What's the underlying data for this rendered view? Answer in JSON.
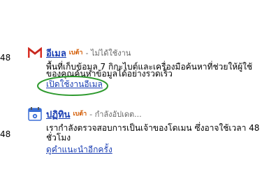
{
  "cut_text": {
    "first": "48",
    "second": "48"
  },
  "services": {
    "mail": {
      "icon": "gmail-m-icon",
      "name": "อีเมล",
      "beta": "เบต้า",
      "status": "- ไม่ได้ใช้งาน",
      "desc_line1": "พื้นที่เก็บข้อมูล 7 กิกะไบต์และเครื่องมือค้นหาที่ช่วยให้ผู้ใช้",
      "desc_line2": "ของคุณค้นหาข้อมูลได้อย่างรวดเร็ว",
      "action": "เปิดใช้งานอีเมล"
    },
    "calendar": {
      "icon": "calendar-icon",
      "name": "ปฏิทิน",
      "beta": "เบต้า",
      "status": "- กำลังอัปเดต...",
      "desc_line1": "เรากำลังตรวจสอบการเป็นเจ้าของโดเมน ซึ่งอาจใช้เวลา 48",
      "desc_line2": "ชั่วโมง",
      "action": "ดูคำแนะนำอีกครั้ง"
    }
  },
  "colors": {
    "link": "#1a3eb3",
    "beta": "#d35a00",
    "status": "#666666",
    "highlight_ring": "#2e9a2e",
    "gmail_red": "#d93025"
  }
}
